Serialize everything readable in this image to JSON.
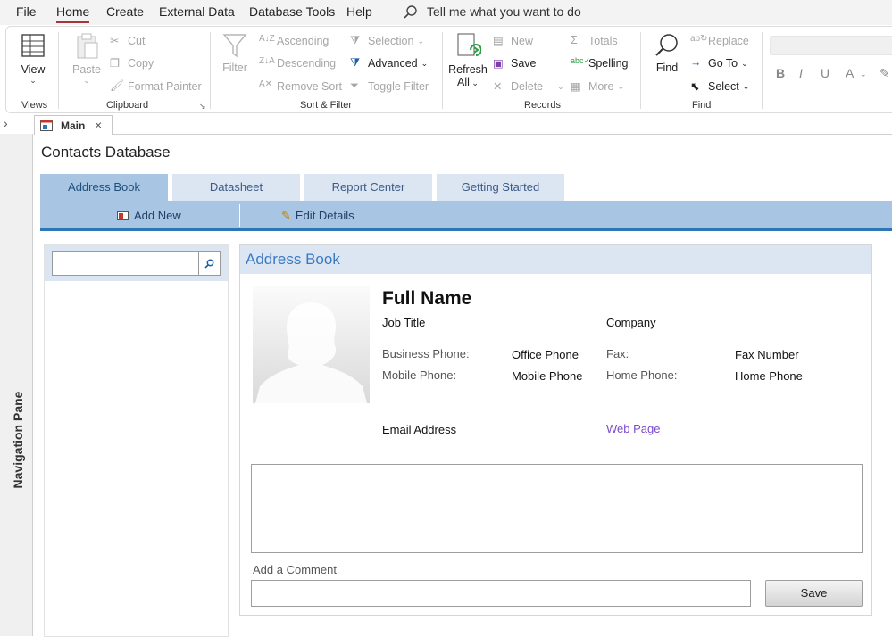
{
  "menubar": {
    "items": [
      "File",
      "Home",
      "Create",
      "External Data",
      "Database Tools",
      "Help"
    ],
    "tell_me": "Tell me what you want to do"
  },
  "ribbon": {
    "views": {
      "view_label": "View",
      "group": "Views"
    },
    "clipboard": {
      "paste": "Paste",
      "cut": "Cut",
      "copy": "Copy",
      "format_painter": "Format Painter",
      "group": "Clipboard"
    },
    "sort_filter": {
      "filter": "Filter",
      "ascending": "Ascending",
      "descending": "Descending",
      "remove_sort": "Remove Sort",
      "selection": "Selection",
      "advanced": "Advanced",
      "toggle_filter": "Toggle Filter",
      "group": "Sort & Filter"
    },
    "records": {
      "refresh_all": "Refresh",
      "refresh_all_2": "All",
      "new": "New",
      "save": "Save",
      "delete": "Delete",
      "totals": "Totals",
      "spelling": "Spelling",
      "more": "More",
      "group": "Records"
    },
    "find": {
      "find": "Find",
      "replace": "Replace",
      "go_to": "Go To",
      "select": "Select",
      "group": "Find"
    },
    "text_format": {
      "bold": "B",
      "italic": "I",
      "underline": "U",
      "font_color": "A"
    }
  },
  "tabs": {
    "main": "Main"
  },
  "nav_pane": {
    "label": "Navigation Pane"
  },
  "form": {
    "title": "Contacts Database",
    "tabs": [
      "Address Book",
      "Datasheet",
      "Report Center",
      "Getting Started"
    ],
    "actions": {
      "add_new": "Add New",
      "edit_details": "Edit Details"
    },
    "search": {
      "placeholder": ""
    },
    "card": {
      "header": "Address Book",
      "full_name": "Full Name",
      "job_title": "Job Title",
      "company": "Company",
      "business_phone_label": "Business Phone:",
      "business_phone": "Office Phone",
      "mobile_phone_label": "Mobile Phone:",
      "mobile_phone": "Mobile Phone",
      "fax_label": "Fax:",
      "fax": "Fax Number",
      "home_phone_label": "Home Phone:",
      "home_phone": "Home Phone",
      "email": "Email Address",
      "web_page": "Web Page",
      "add_comment_label": "Add a Comment",
      "save_button": "Save"
    }
  },
  "colors": {
    "accent": "#a4373a",
    "tab_blue": "#a8c5e3",
    "link_purple": "#7b4cc9"
  }
}
